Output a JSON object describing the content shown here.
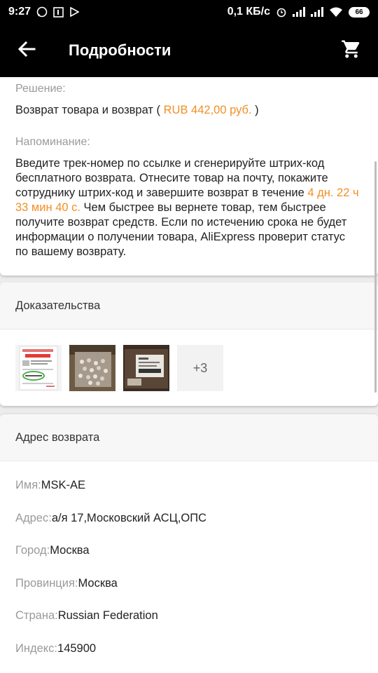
{
  "status_bar": {
    "time": "9:27",
    "network_speed": "0,1 КБ/с",
    "battery": "66",
    "icons": [
      "whatsapp-icon",
      "notification-icon",
      "play-icon",
      "alarm-icon",
      "signal-icon",
      "signal-icon",
      "wifi-icon",
      "battery-icon"
    ]
  },
  "app_bar": {
    "title": "Подробности",
    "back_icon": "arrow-left-icon",
    "cart_icon": "shopping-cart-icon"
  },
  "decision": {
    "label": "Решение:",
    "text_prefix": "Возврат товара и возврат ( ",
    "amount": "RUB 442,00 руб.",
    "text_suffix": " )"
  },
  "reminder": {
    "label": "Напоминание:",
    "text_part1": "Введите трек-номер по ссылке и сгенерируйте штрих-код бесплатного возврата. Отнесите товар на почту, покажите сотруднику штрих-код и завершите возврат в течение ",
    "countdown": "4 дн. 22 ч 33 мин 40 с.",
    "text_part2": " Чем быстрее вы вернете товар, тем быстрее получите возврат средств. Если по истечению срока не будет информации о получении товара, AliExpress проверит статус по вашему возврату."
  },
  "evidence": {
    "title": "Доказательства",
    "more_label": "+3"
  },
  "return_address": {
    "title": "Адрес возврата",
    "rows": [
      {
        "key": "Имя:",
        "value": "MSK-AE"
      },
      {
        "key": "Адрес:",
        "value": "а/я 17,Московский АСЦ,ОПС"
      },
      {
        "key": "Город:",
        "value": "Москва"
      },
      {
        "key": "Провинция:",
        "value": "Москва"
      },
      {
        "key": "Страна:",
        "value": "Russian Federation"
      },
      {
        "key": "Индекс:",
        "value": "145900"
      }
    ]
  },
  "colors": {
    "accent": "#f28f24",
    "app_bar": "#000000",
    "label": "#9a9a9a"
  }
}
